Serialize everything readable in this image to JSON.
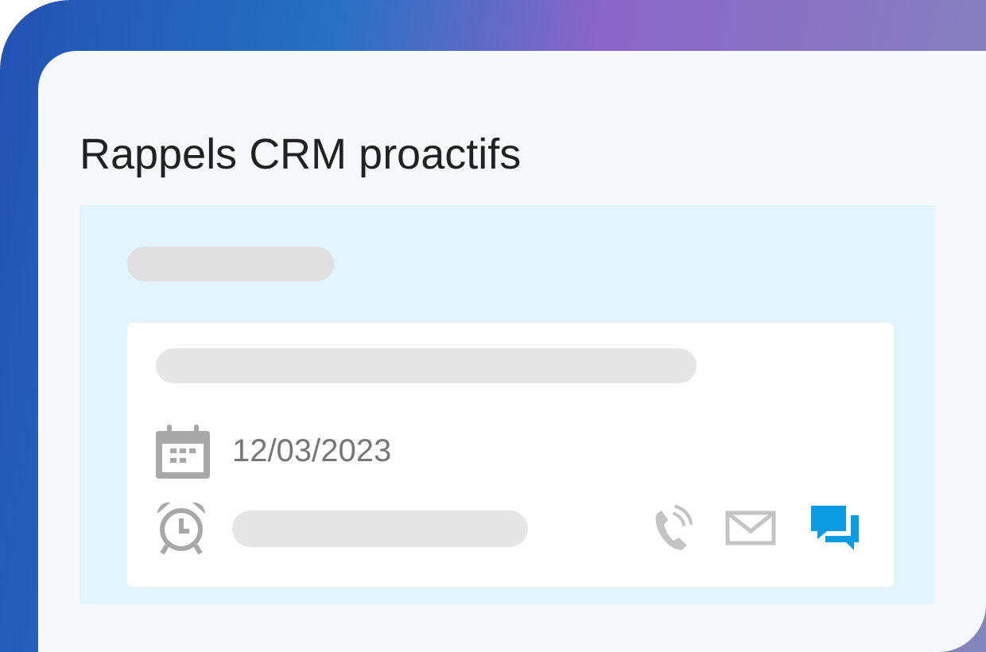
{
  "card": {
    "title": "Rappels CRM proactifs"
  },
  "reminder": {
    "date": "12/03/2023",
    "channels": [
      {
        "kind": "phone",
        "selected": false
      },
      {
        "kind": "email",
        "selected": false
      },
      {
        "kind": "chat",
        "selected": true
      }
    ]
  }
}
